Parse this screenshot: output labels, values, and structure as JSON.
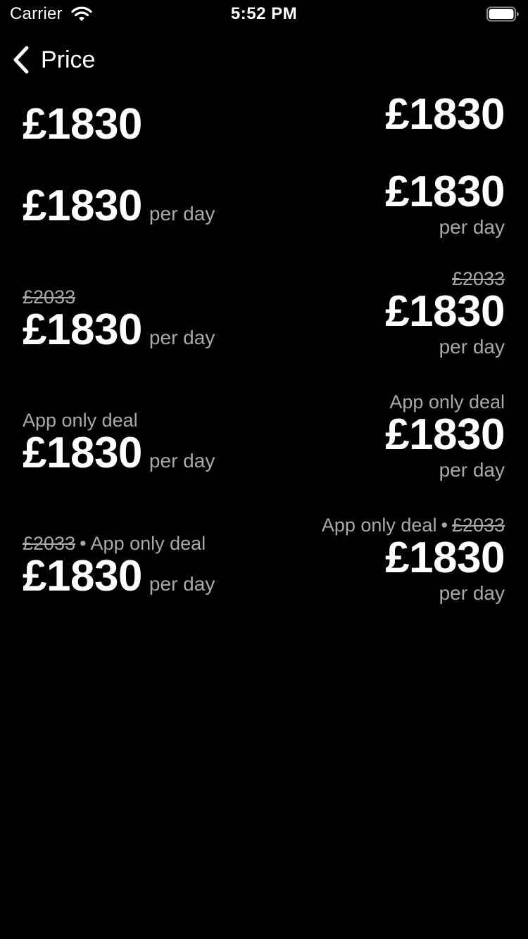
{
  "status_bar": {
    "carrier": "Carrier",
    "time": "5:52 PM",
    "icons": [
      "wifi-icon",
      "battery-icon"
    ]
  },
  "nav": {
    "back_label": "Price",
    "back_icon": "chevron-left-icon"
  },
  "colors": {
    "background": "#000000",
    "primary_text": "#ffffff",
    "secondary_text": "#a8a8ad"
  },
  "price_variants": [
    {
      "left": {
        "amount": "£1830"
      },
      "right": {
        "amount": "£1830"
      }
    },
    {
      "left": {
        "amount": "£1830",
        "unit": "per day"
      },
      "right": {
        "amount": "£1830",
        "unit": "per day"
      }
    },
    {
      "left": {
        "was": "£2033",
        "amount": "£1830",
        "unit": "per day"
      },
      "right": {
        "was": "£2033",
        "amount": "£1830",
        "unit": "per day"
      }
    },
    {
      "left": {
        "deal": "App only deal",
        "amount": "£1830",
        "unit": "per day"
      },
      "right": {
        "deal": "App only deal",
        "amount": "£1830",
        "unit": "per day"
      }
    },
    {
      "left": {
        "was": "£2033",
        "separator": "•",
        "deal": "App only deal",
        "amount": "£1830",
        "unit": "per day"
      },
      "right": {
        "deal": "App only deal",
        "separator": "•",
        "was": "£2033",
        "amount": "£1830",
        "unit": "per day"
      }
    }
  ]
}
